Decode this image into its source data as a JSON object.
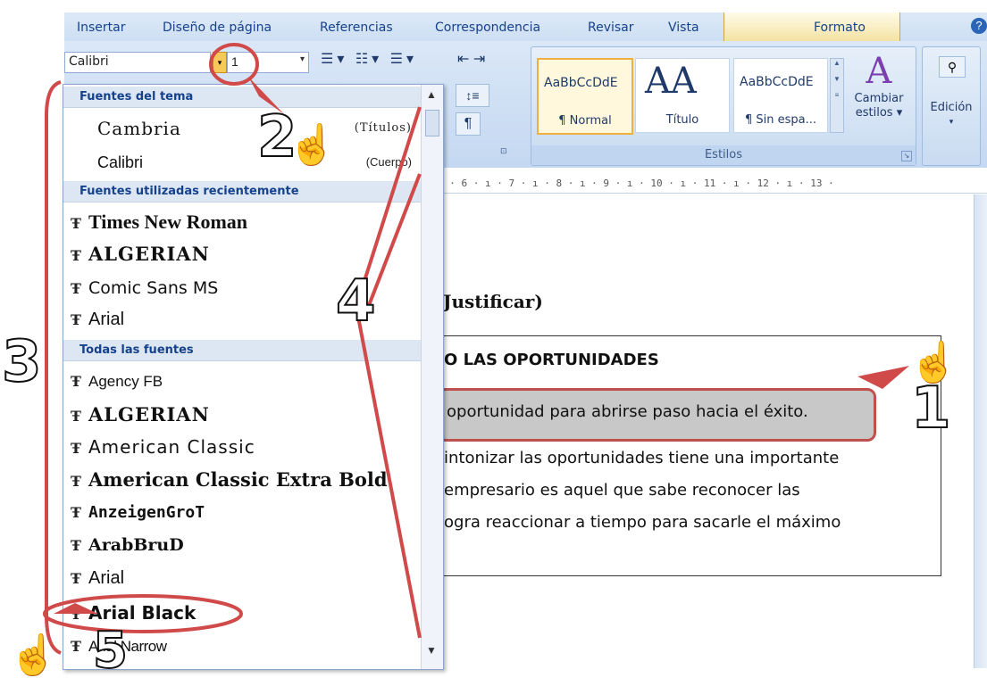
{
  "ribbon": {
    "tabs": [
      "Insertar",
      "Diseño de página",
      "Referencias",
      "Correspondencia",
      "Revisar",
      "Vista",
      "Formato"
    ],
    "font_name_value": "Calibri",
    "font_size_value": "1",
    "styles": [
      {
        "sample": "AaBbCcDdE",
        "name": "¶ Normal"
      },
      {
        "sample": "AA",
        "name": "Título"
      },
      {
        "sample": "AaBbCcDdE",
        "name": "¶ Sin espa..."
      }
    ],
    "styles_group_label": "Estilos",
    "change_styles_label": "Cambiar estilos ▾",
    "edit_label": "Edición",
    "paragraph_mark": "¶"
  },
  "ruler": {
    "text": "  · 6 · ı · 7 · ı · 8 · ı · 9 · ı · 10 · ı · 11 · ı · 12 · ı · 13 ·"
  },
  "font_dropdown": {
    "theme_header": "Fuentes del tema",
    "theme_fonts": [
      {
        "name": "Cambria",
        "hint": "(Títulos)"
      },
      {
        "name": "Calibri",
        "hint": "(Cuerpo)"
      }
    ],
    "recent_header": "Fuentes utilizadas recientemente",
    "recent_fonts": [
      "Times New Roman",
      "ALGERIAN",
      "Comic Sans MS",
      "Arial"
    ],
    "all_header": "Todas las fuentes",
    "all_fonts": [
      "Agency FB",
      "ALGERIAN",
      "American Classic",
      "American Classic Extra Bold",
      "AnzeigenGroT",
      "ArabBruD",
      "Arial",
      "Arial Black",
      "Arial Narrow"
    ],
    "font_icon": "Ŧ"
  },
  "document": {
    "heading": "Justificar)",
    "box_title": "O LAS OPORTUNIDADES",
    "highlighted_line": "oportunidad para abrirse paso hacia el éxito.",
    "para_lines": [
      "intonizar las oportunidades tiene una importante",
      "empresario es aquel que sabe reconocer las",
      "ogra reaccionar a tiempo para sacarle el máximo"
    ]
  },
  "annotations": [
    "1",
    "2",
    "3",
    "4",
    "5"
  ],
  "colors": {
    "annotation": "#d04a4a",
    "ribbon": "#c4d8f1",
    "accent": "#15428b"
  }
}
